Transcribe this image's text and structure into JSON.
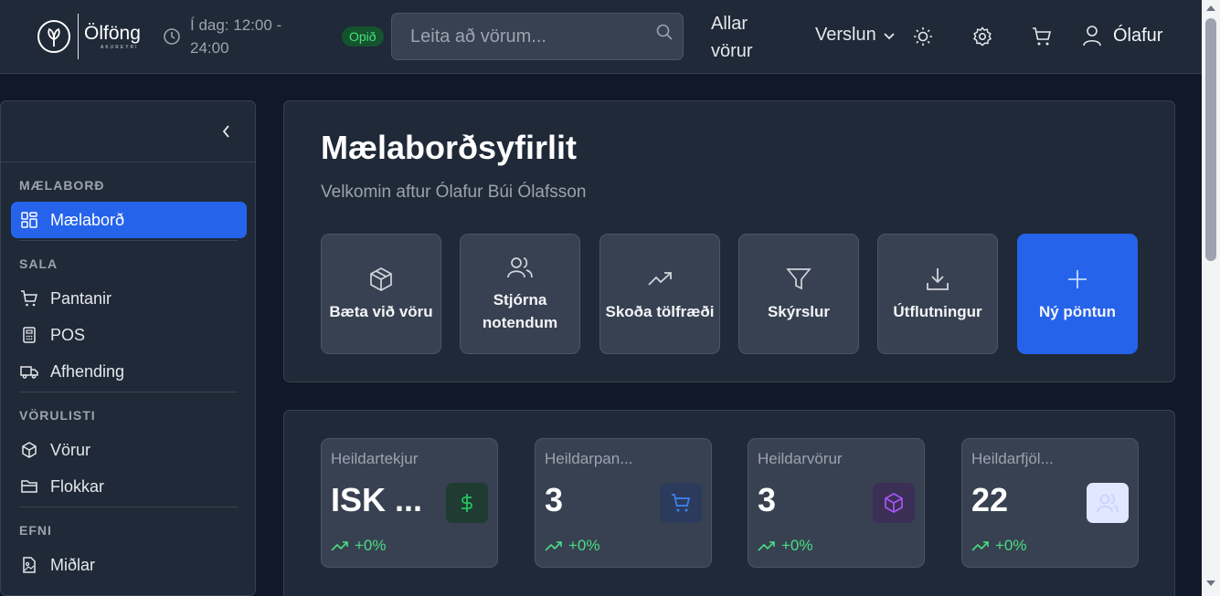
{
  "header": {
    "logo_name": "Ölföng",
    "logo_sub": "AKUREYRI",
    "hours": "Í dag: 12:00 - 24:00",
    "open_badge": "Opið",
    "search_placeholder": "Leita að vörum...",
    "nav_all": "Allar vörur",
    "nav_store": "Verslun",
    "user_name": "Ólafur"
  },
  "sidebar": {
    "sections": [
      {
        "label": "MÆLABORÐ",
        "items": [
          {
            "label": "Mælaborð",
            "icon": "dashboard-icon",
            "active": true
          }
        ]
      },
      {
        "label": "SALA",
        "items": [
          {
            "label": "Pantanir",
            "icon": "cart-icon"
          },
          {
            "label": "POS",
            "icon": "calculator-icon"
          },
          {
            "label": "Afhending",
            "icon": "truck-icon"
          }
        ]
      },
      {
        "label": "VÖRULISTI",
        "items": [
          {
            "label": "Vörur",
            "icon": "box-icon"
          },
          {
            "label": "Flokkar",
            "icon": "folder-icon"
          }
        ]
      },
      {
        "label": "EFNI",
        "items": [
          {
            "label": "Miðlar",
            "icon": "media-icon"
          }
        ]
      }
    ]
  },
  "overview": {
    "title": "Mælaborðsyfirlit",
    "subtitle": "Velkomin aftur Ólafur Búi Ólafsson",
    "actions": [
      {
        "label": "Bæta við vöru",
        "icon": "box-icon"
      },
      {
        "label": "Stjórna notendum",
        "icon": "users-icon"
      },
      {
        "label": "Skoða tölfræði",
        "icon": "trend-up-icon"
      },
      {
        "label": "Skýrslur",
        "icon": "filter-icon"
      },
      {
        "label": "Útflutningur",
        "icon": "download-icon"
      },
      {
        "label": "Ný pöntun",
        "icon": "plus-icon",
        "primary": true
      }
    ]
  },
  "stats": [
    {
      "label": "Heildartekjur",
      "value": "ISK ...",
      "trend": "+0%",
      "icon": "dollar-icon",
      "color": "#22c55e"
    },
    {
      "label": "Heildarpan...",
      "value": "3",
      "trend": "+0%",
      "icon": "cart-icon",
      "color": "#3b82f6"
    },
    {
      "label": "Heildarvörur",
      "value": "3",
      "trend": "+0%",
      "icon": "box-icon",
      "color": "#a855f7"
    },
    {
      "label": "Heildarfjöl...",
      "value": "22",
      "trend": "+0%",
      "icon": "users-icon",
      "color": "#e0e7ff"
    }
  ],
  "colors": {
    "accent": "#2563eb",
    "success": "#4ade80"
  }
}
